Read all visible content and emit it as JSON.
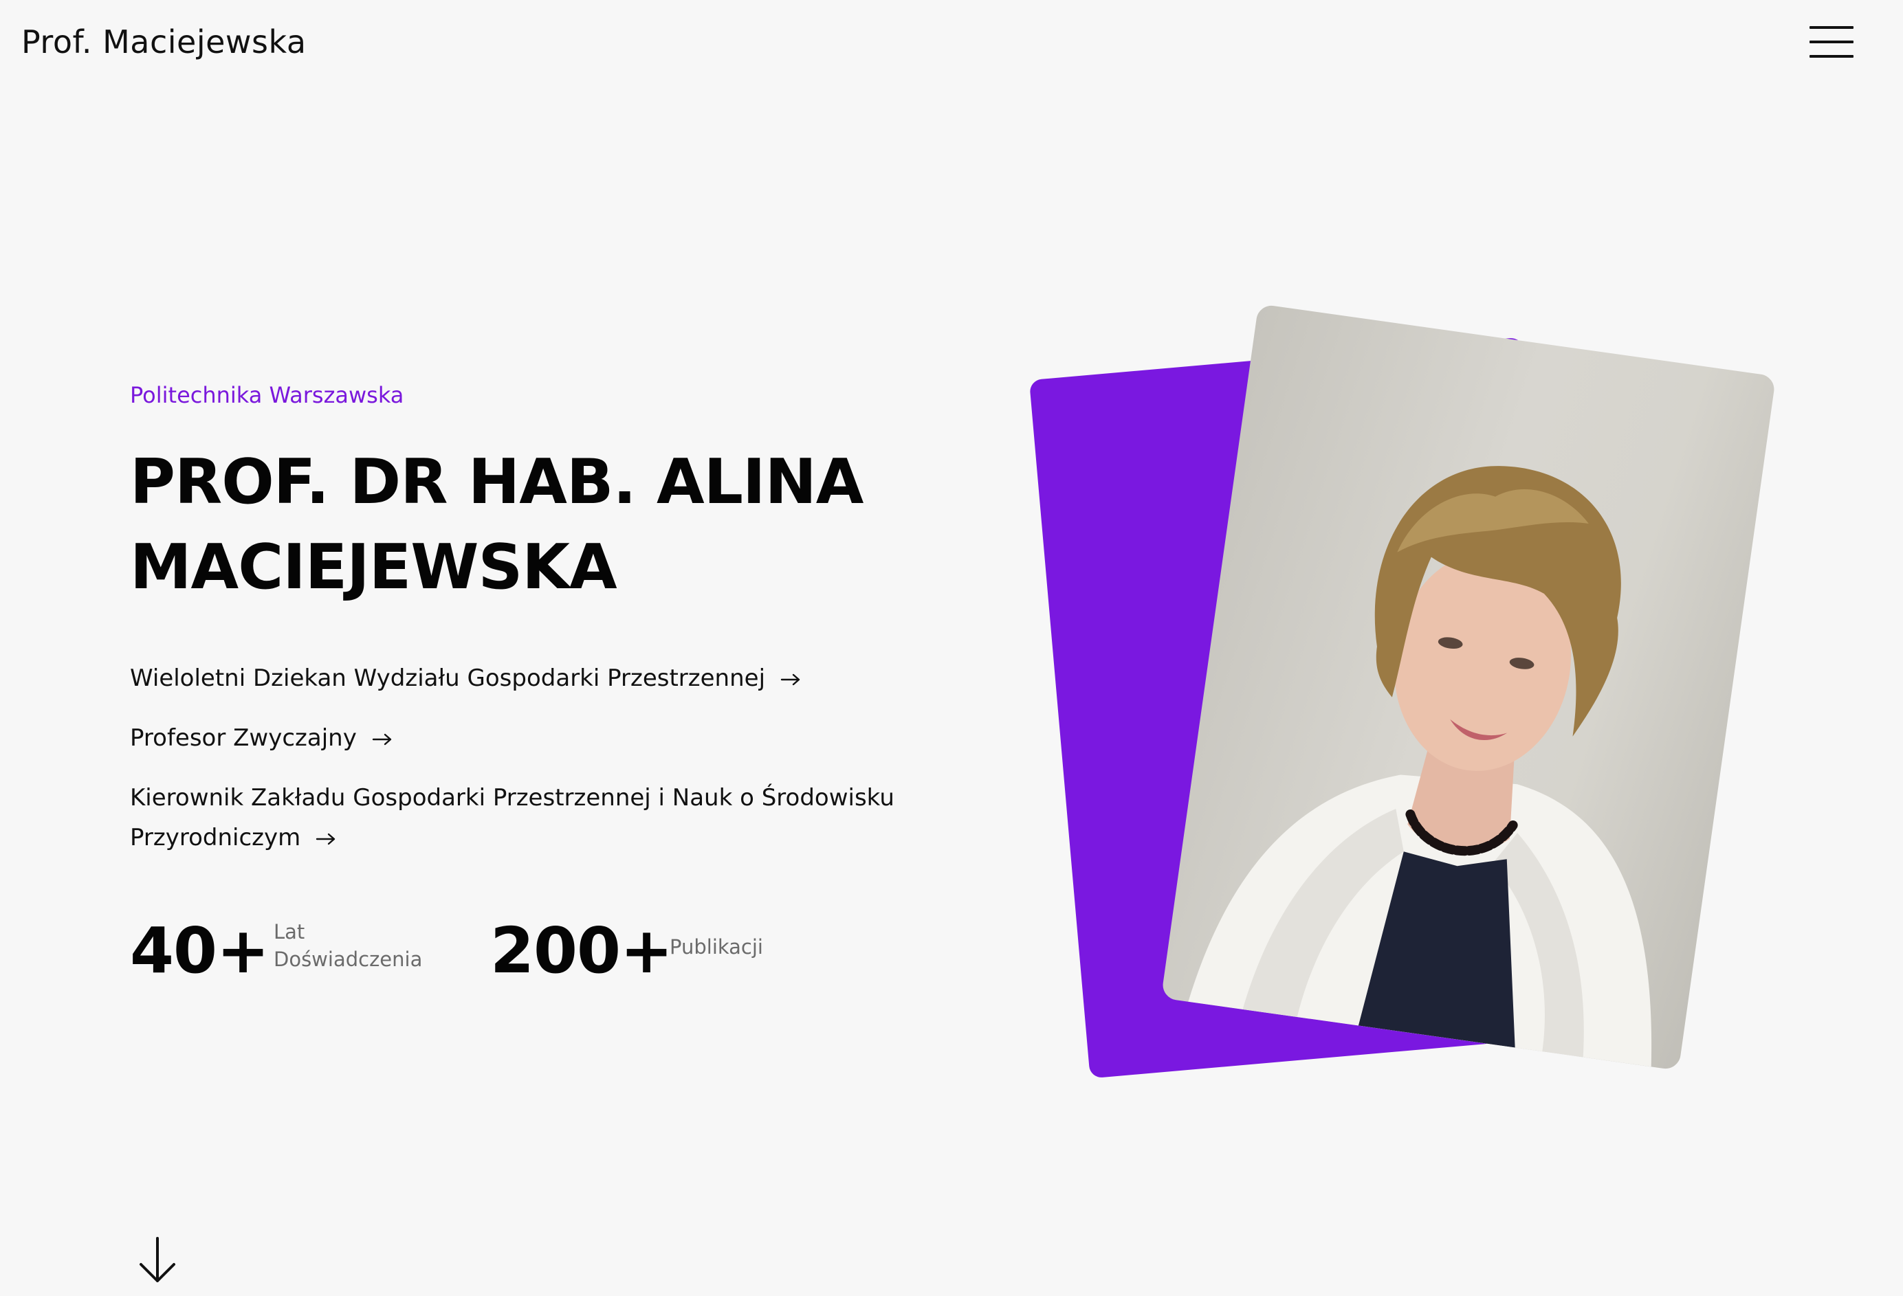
{
  "header": {
    "logo_text": "Prof. Maciejewska",
    "menu_icon": "hamburger-menu-icon"
  },
  "hero": {
    "eyebrow": "Politechnika Warszawska",
    "title": "PROF. DR HAB. ALINA MACIEJEWSKA",
    "roles": [
      {
        "label": "Wieloletni Dziekan Wydziału Gospodarki Przestrzennej",
        "icon": "arrow-right-icon"
      },
      {
        "label": "Profesor Zwyczajny",
        "icon": "arrow-right-icon"
      },
      {
        "label": "Kierownik Zakładu Gospodarki Przestrzennej i Nauk o Środowisku Przyrodniczym",
        "icon": "arrow-right-icon"
      }
    ],
    "stats": [
      {
        "value": "40+",
        "label": "Lat Doświadczenia"
      },
      {
        "value": "200+",
        "label": "Publikacji"
      }
    ],
    "scroll_icon": "arrow-down-icon"
  },
  "colors": {
    "accent": "#7a18dc",
    "background": "#f7f7f7",
    "text": "#050505",
    "muted": "#6b6b6b"
  }
}
